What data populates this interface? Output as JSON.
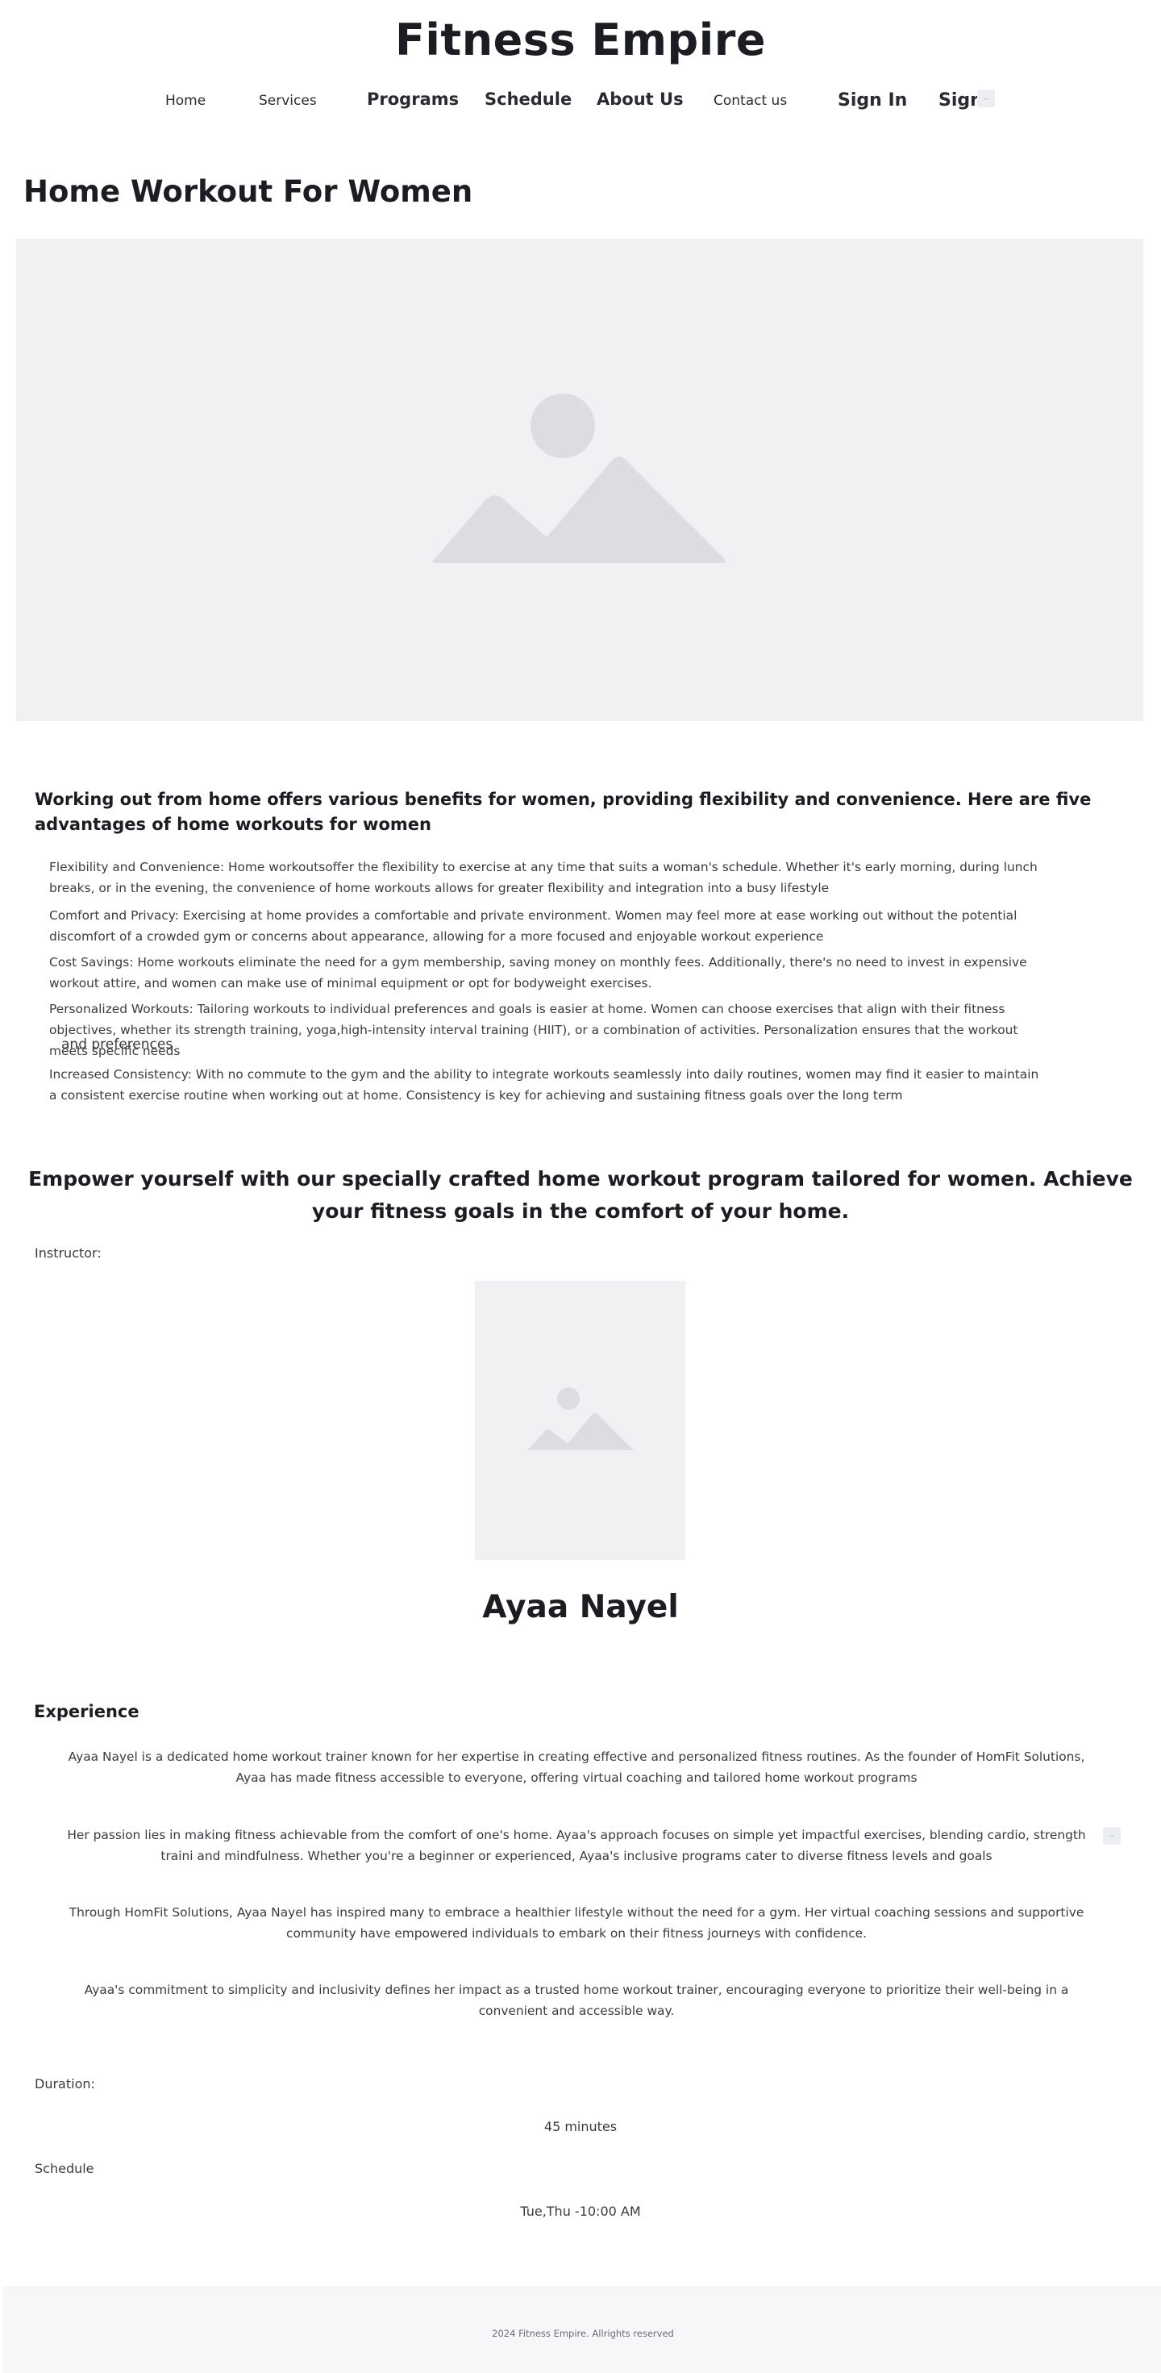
{
  "site": {
    "title": "Fitness Empire"
  },
  "nav": {
    "home": "Home",
    "services": "Services",
    "programs": "Programs",
    "schedule": "Schedule",
    "about": "About Us",
    "contact": "Contact us",
    "sign_in": "Sign In",
    "sign": "Sign"
  },
  "page": {
    "heading": "Home Workout For Women"
  },
  "benefits": {
    "heading": "Working out from home offers various benefits for women, providing flexibility and convenience. Here are five advantages of home workouts for women",
    "items": [
      {
        "text": "Flexibility and Convenience: Home workoutsoffer the flexibility to exercise at any time that suits a woman's schedule. Whether it's early morning, during lunch breaks, or in the evening, the convenience of home workouts allows for greater flexibility and integration into a busy lifestyle"
      },
      {
        "text": "Comfort and Privacy: Exercising at home provides a comfortable and private environment. Women may feel more at ease working out without the potential discomfort of a crowded gym or concerns about appearance, allowing for a more focused and enjoyable workout experience"
      },
      {
        "text": "Cost Savings: Home workouts eliminate the need for a gym membership, saving money on monthly fees. Additionally, there's no need to invest in expensive workout attire, and women can make use of minimal equipment or opt for bodyweight exercises."
      },
      {
        "text": " Personalized Workouts: Tailoring workouts to individual preferences and goals is easier at home. Women can choose exercises that align with their fitness objectives, whether its strength training, yoga,high-intensity interval training (HIIT), or a combination of activities. Personalization ensures that the workout meets specific needs"
      },
      {
        "text": "Increased Consistency: With no commute to the gym and the ability to integrate workouts seamlessly into daily routines, women may find it easier to maintain a consistent exercise routine when working out at home. Consistency is key for achieving and sustaining fitness goals over the long term"
      }
    ],
    "stray_text": "and preferences"
  },
  "cta": {
    "text": "Empower yourself with our specially crafted home workout program tailored for women. Achieve your fitness goals in the comfort of your home."
  },
  "instructor": {
    "label": "Instructor:",
    "name": "Ayaa Nayel"
  },
  "experience": {
    "heading": "Experience",
    "paragraphs": [
      "Ayaa Nayel is a dedicated home workout trainer known for her expertise in creating effective and personalized fitness routines. As the founder of HomFit Solutions, Ayaa has made fitness accessible to everyone, offering virtual coaching and tailored home workout programs",
      "Her passion lies in making fitness achievable from the comfort of one's home. Ayaa's approach focuses on simple yet impactful exercises, blending cardio, strength traini and mindfulness. Whether you're a beginner or experienced, Ayaa's inclusive programs cater to diverse fitness levels and goals",
      "Through HomFit Solutions, Ayaa Nayel has inspired many to embrace a healthier lifestyle without the need for a gym. Her virtual coaching sessions and supportive community have empowered individuals to embark on their fitness journeys with confidence.",
      "Ayaa's commitment to simplicity and inclusivity defines her impact as a trusted home workout trainer, encouraging everyone to prioritize their well-being in a convenient and accessible way."
    ]
  },
  "details": {
    "duration_label": "Duration:",
    "duration_value": "45 minutes",
    "schedule_label": "Schedule",
    "schedule_value": "Tue,Thu -10:00 AM"
  },
  "footer": {
    "text": "2024 Fitness Empire. Allrights reserved"
  },
  "colors": {
    "text_dark": "#1c1d22",
    "text_body": "#3a3b40",
    "placeholder_bg": "#f1f1f3",
    "placeholder_shape": "#dcdde0",
    "footer_bg": "#f7f7f9"
  }
}
